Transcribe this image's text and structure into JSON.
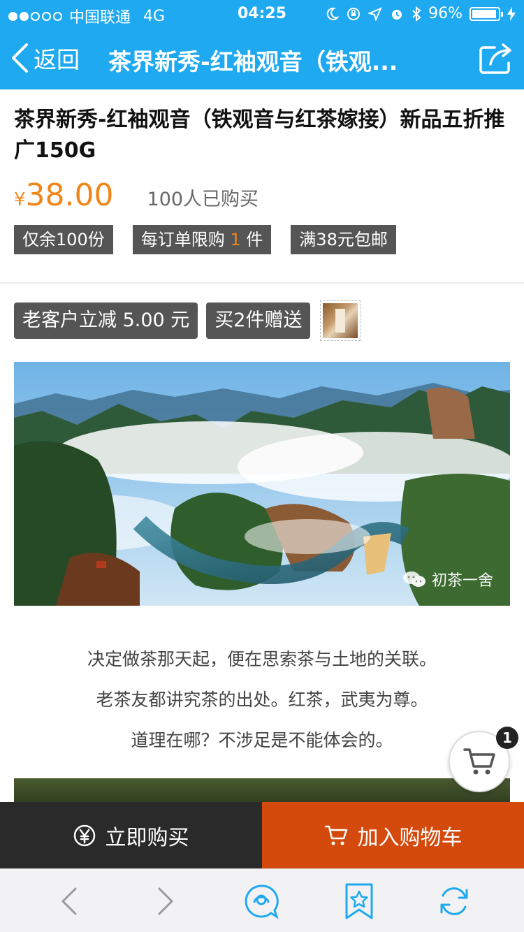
{
  "status_bar": {
    "carrier": "中国联通",
    "network": "4G",
    "time": "04:25",
    "battery_percent": "96%"
  },
  "nav": {
    "back_label": "返回",
    "title": "茶界新秀-红袖观音（铁观...",
    "share_icon": "share-icon"
  },
  "product": {
    "title": "茶界新秀-红袖观音（铁观音与红茶嫁接）新品五折推广150G",
    "price_symbol": "¥",
    "price": "38.00",
    "sold": "100人已购买",
    "tags": {
      "stock": "仅余100份",
      "limit_prefix": "每订单限购",
      "limit_count": "1",
      "limit_suffix": "件",
      "shipping": "满38元包邮"
    }
  },
  "promotions": {
    "discount": "老客户立减 5.00 元",
    "gift": "买2件赠送"
  },
  "hero_image": {
    "watermark": "初茶一舍"
  },
  "description": [
    "决定做茶那天起，便在思索茶与土地的关联。",
    "老茶友都讲究茶的出处。红茶，武夷为尊。",
    "道理在哪？不涉足是不能体会的。"
  ],
  "cart": {
    "badge_count": "1"
  },
  "actions": {
    "buy_now": "立即购买",
    "add_to_cart": "加入购物车"
  },
  "colors": {
    "brand_blue": "#1fa9f0",
    "price_orange": "#f08519",
    "cart_orange": "#d44a0c",
    "dark": "#2a2a2a"
  }
}
